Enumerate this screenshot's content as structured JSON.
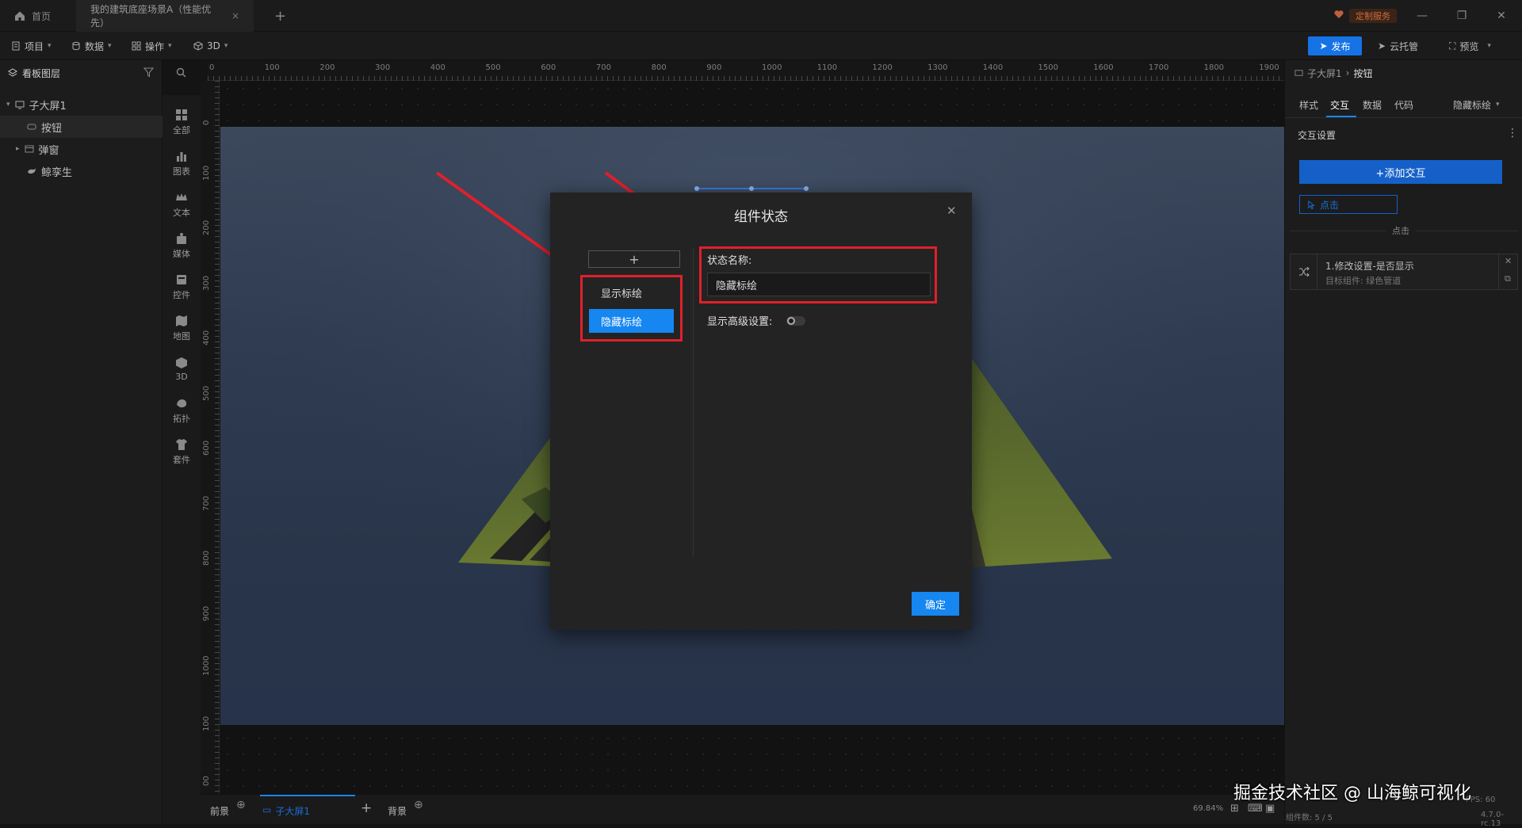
{
  "titlebar": {
    "home_label": "首页",
    "doc_tab_label": "我的建筑底座场景A（性能优先）",
    "custom_service_label": "定制服务"
  },
  "toolbar": {
    "menus": [
      "项目",
      "数据",
      "操作",
      "3D"
    ],
    "publish_label": "发布",
    "cloud_label": "云托管",
    "preview_label": "预览"
  },
  "layers": {
    "title": "看板图层",
    "items": [
      "子大屏1",
      "按钮",
      "弹窗",
      "鲸孪生"
    ]
  },
  "components": [
    "全部",
    "图表",
    "文本",
    "媒体",
    "控件",
    "地图",
    "3D",
    "拓扑",
    "套件"
  ],
  "ruler": {
    "h_ticks": [
      "0",
      "100",
      "200",
      "300",
      "400",
      "500",
      "600",
      "700",
      "800",
      "900",
      "1000",
      "1100",
      "1200",
      "1300",
      "1400",
      "1500",
      "1600",
      "1700",
      "1800",
      "1900"
    ],
    "v_ticks": [
      "0",
      "100",
      "200",
      "300",
      "400",
      "500",
      "600",
      "700",
      "800",
      "900",
      "1000",
      "100",
      "00"
    ]
  },
  "modal": {
    "title": "组件状态",
    "add_symbol": "+",
    "states": [
      "显示标绘",
      "隐藏标绘"
    ],
    "state_name_label": "状态名称:",
    "state_name_value": "隐藏标绘",
    "advanced_label": "显示高级设置:",
    "advanced_enabled": false,
    "confirm_label": "确定"
  },
  "props": {
    "breadcrumb_parent": "子大屏1",
    "breadcrumb_current": "按钮",
    "tabs": [
      "样式",
      "交互",
      "数据",
      "代码"
    ],
    "active_tab": "交互",
    "state_select": "隐藏标绘",
    "section_title": "交互设置",
    "add_interaction_label": "+添加交互",
    "trigger_label": "点击",
    "divider_label": "点击",
    "action_title": "1.修改设置-是否显示",
    "action_subtitle": "目标组件: 绿色管道"
  },
  "bottombar": {
    "foreground_label": "前景",
    "screen_label": "子大屏1",
    "background_label": "背景",
    "zoom": "69.84%",
    "stats_text": "FPS: 60",
    "component_count": "组件数: 5 / 5",
    "version": "4.7.0-rc.13"
  },
  "watermark": "掘金技术社区 @ 山海鲸可视化",
  "colors": {
    "accent": "#1573e6",
    "highlight": "#e0202a",
    "panel": "#1c1c1c"
  }
}
